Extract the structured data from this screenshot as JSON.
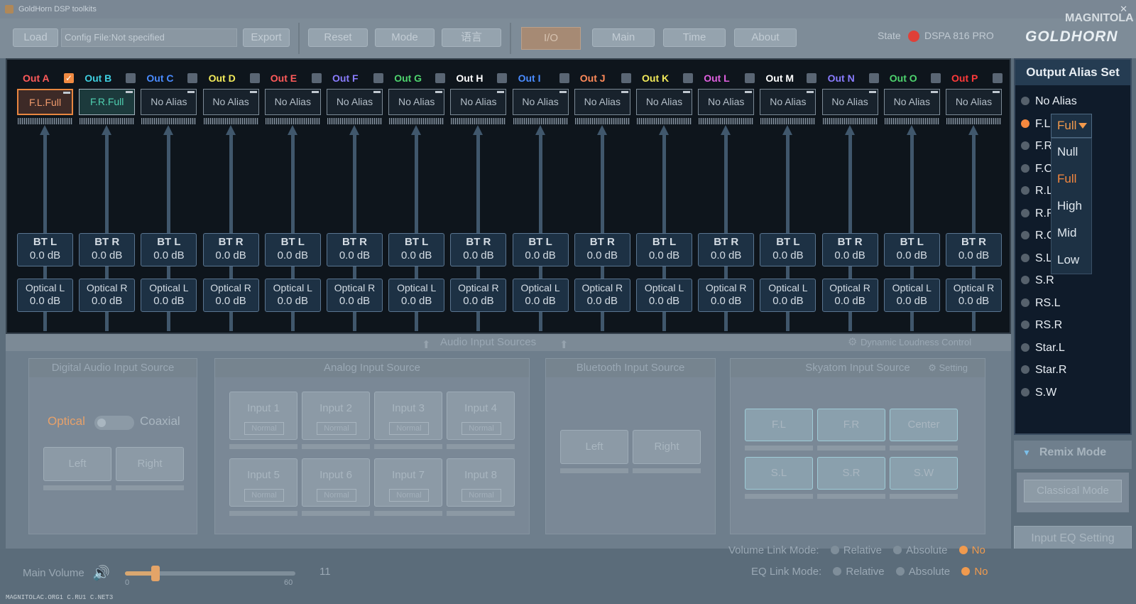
{
  "window": {
    "title": "GoldHorn DSP toolkits"
  },
  "toolbar": {
    "load": "Load",
    "config_file": "Config File:Not specified",
    "export": "Export",
    "reset": "Reset",
    "mode": "Mode",
    "lang": "语言",
    "tabs": [
      "I/O",
      "Main",
      "Time",
      "About"
    ],
    "state_label": "State",
    "device": "DSPA 816 PRO"
  },
  "brand": {
    "logo": "GOLDHORN",
    "watermark": "MAGNITOLA"
  },
  "outputs": [
    {
      "label": "Out A",
      "color": "#ff5a5a",
      "checked": true,
      "alias": "F.L.Full",
      "bt": "BT L",
      "bt_db": "0.0 dB",
      "opt": "Optical L",
      "opt_db": "0.0 dB"
    },
    {
      "label": "Out B",
      "color": "#3ecfe0",
      "checked": false,
      "alias": "F.R.Full",
      "bt": "BT R",
      "bt_db": "0.0 dB",
      "opt": "Optical R",
      "opt_db": "0.0 dB"
    },
    {
      "label": "Out C",
      "color": "#4a8cff",
      "checked": false,
      "alias": "No Alias",
      "bt": "BT L",
      "bt_db": "0.0 dB",
      "opt": "Optical L",
      "opt_db": "0.0 dB"
    },
    {
      "label": "Out D",
      "color": "#f2ea5a",
      "checked": false,
      "alias": "No Alias",
      "bt": "BT R",
      "bt_db": "0.0 dB",
      "opt": "Optical R",
      "opt_db": "0.0 dB"
    },
    {
      "label": "Out E",
      "color": "#ff5a5a",
      "checked": false,
      "alias": "No Alias",
      "bt": "BT L",
      "bt_db": "0.0 dB",
      "opt": "Optical L",
      "opt_db": "0.0 dB"
    },
    {
      "label": "Out F",
      "color": "#8a7cff",
      "checked": false,
      "alias": "No Alias",
      "bt": "BT R",
      "bt_db": "0.0 dB",
      "opt": "Optical R",
      "opt_db": "0.0 dB"
    },
    {
      "label": "Out G",
      "color": "#4ed46e",
      "checked": false,
      "alias": "No Alias",
      "bt": "BT L",
      "bt_db": "0.0 dB",
      "opt": "Optical L",
      "opt_db": "0.0 dB"
    },
    {
      "label": "Out H",
      "color": "#ffffff",
      "checked": false,
      "alias": "No Alias",
      "bt": "BT R",
      "bt_db": "0.0 dB",
      "opt": "Optical R",
      "opt_db": "0.0 dB"
    },
    {
      "label": "Out I",
      "color": "#4a8cff",
      "checked": false,
      "alias": "No Alias",
      "bt": "BT L",
      "bt_db": "0.0 dB",
      "opt": "Optical L",
      "opt_db": "0.0 dB"
    },
    {
      "label": "Out J",
      "color": "#ff8a5a",
      "checked": false,
      "alias": "No Alias",
      "bt": "BT R",
      "bt_db": "0.0 dB",
      "opt": "Optical R",
      "opt_db": "0.0 dB"
    },
    {
      "label": "Out K",
      "color": "#f2ea5a",
      "checked": false,
      "alias": "No Alias",
      "bt": "BT L",
      "bt_db": "0.0 dB",
      "opt": "Optical L",
      "opt_db": "0.0 dB"
    },
    {
      "label": "Out L",
      "color": "#e060e0",
      "checked": false,
      "alias": "No Alias",
      "bt": "BT R",
      "bt_db": "0.0 dB",
      "opt": "Optical R",
      "opt_db": "0.0 dB"
    },
    {
      "label": "Out M",
      "color": "#ffffff",
      "checked": false,
      "alias": "No Alias",
      "bt": "BT L",
      "bt_db": "0.0 dB",
      "opt": "Optical L",
      "opt_db": "0.0 dB"
    },
    {
      "label": "Out N",
      "color": "#8a7cff",
      "checked": false,
      "alias": "No Alias",
      "bt": "BT R",
      "bt_db": "0.0 dB",
      "opt": "Optical R",
      "opt_db": "0.0 dB"
    },
    {
      "label": "Out O",
      "color": "#4ed46e",
      "checked": false,
      "alias": "No Alias",
      "bt": "BT L",
      "bt_db": "0.0 dB",
      "opt": "Optical L",
      "opt_db": "0.0 dB"
    },
    {
      "label": "Out P",
      "color": "#ff3a3a",
      "checked": false,
      "alias": "No Alias",
      "bt": "BT R",
      "bt_db": "0.0 dB",
      "opt": "Optical R",
      "opt_db": "0.0 dB"
    }
  ],
  "alias_panel": {
    "title": "Output Alias Set",
    "items": [
      "No Alias",
      "F.L",
      "F.R",
      "F.C",
      "R.L",
      "R.R",
      "R.C",
      "S.L",
      "S.R",
      "RS.L",
      "RS.R",
      "Star.L",
      "Star.R",
      "S.W"
    ],
    "selected_index": 1,
    "dropdown_value": "Full",
    "dropdown_options": [
      "Null",
      "Full",
      "High",
      "Mid",
      "Low"
    ]
  },
  "input_sources": {
    "header": "Audio Input Sources",
    "dynamic": "Dynamic Loudness Control",
    "digital": {
      "title": "Digital Audio Input Source",
      "optical": "Optical",
      "coaxial": "Coaxial",
      "left": "Left",
      "right": "Right"
    },
    "analog": {
      "title": "Analog Input Source",
      "inputs": [
        "Input 1",
        "Input 2",
        "Input 3",
        "Input 4",
        "Input 5",
        "Input 6",
        "Input 7",
        "Input 8"
      ],
      "mode": "Normal"
    },
    "bluetooth": {
      "title": "Bluetooth Input Source",
      "left": "Left",
      "right": "Right"
    },
    "skyatom": {
      "title": "Skyatom Input Source",
      "setting": "Setting",
      "buttons": [
        "F.L",
        "F.R",
        "Center",
        "S.L",
        "S.R",
        "S.W"
      ]
    }
  },
  "remix": {
    "title": "Remix Mode",
    "mode": "Classical Mode",
    "input_eq": "Input EQ Setting"
  },
  "volume": {
    "label": "Main Volume",
    "value": "11",
    "min": "0",
    "max": "60",
    "level": 0.18
  },
  "link": {
    "volume_label": "Volume Link Mode:",
    "eq_label": "EQ Link Mode:",
    "options": [
      "Relative",
      "Absolute",
      "No"
    ]
  },
  "footer": {
    "text": "MAGNITOLAC.ORG1 C.RU1 C.NET3"
  },
  "colors": {
    "accent": "#f5883f",
    "panel": "#0e151c",
    "state_dot": "#e04038"
  }
}
